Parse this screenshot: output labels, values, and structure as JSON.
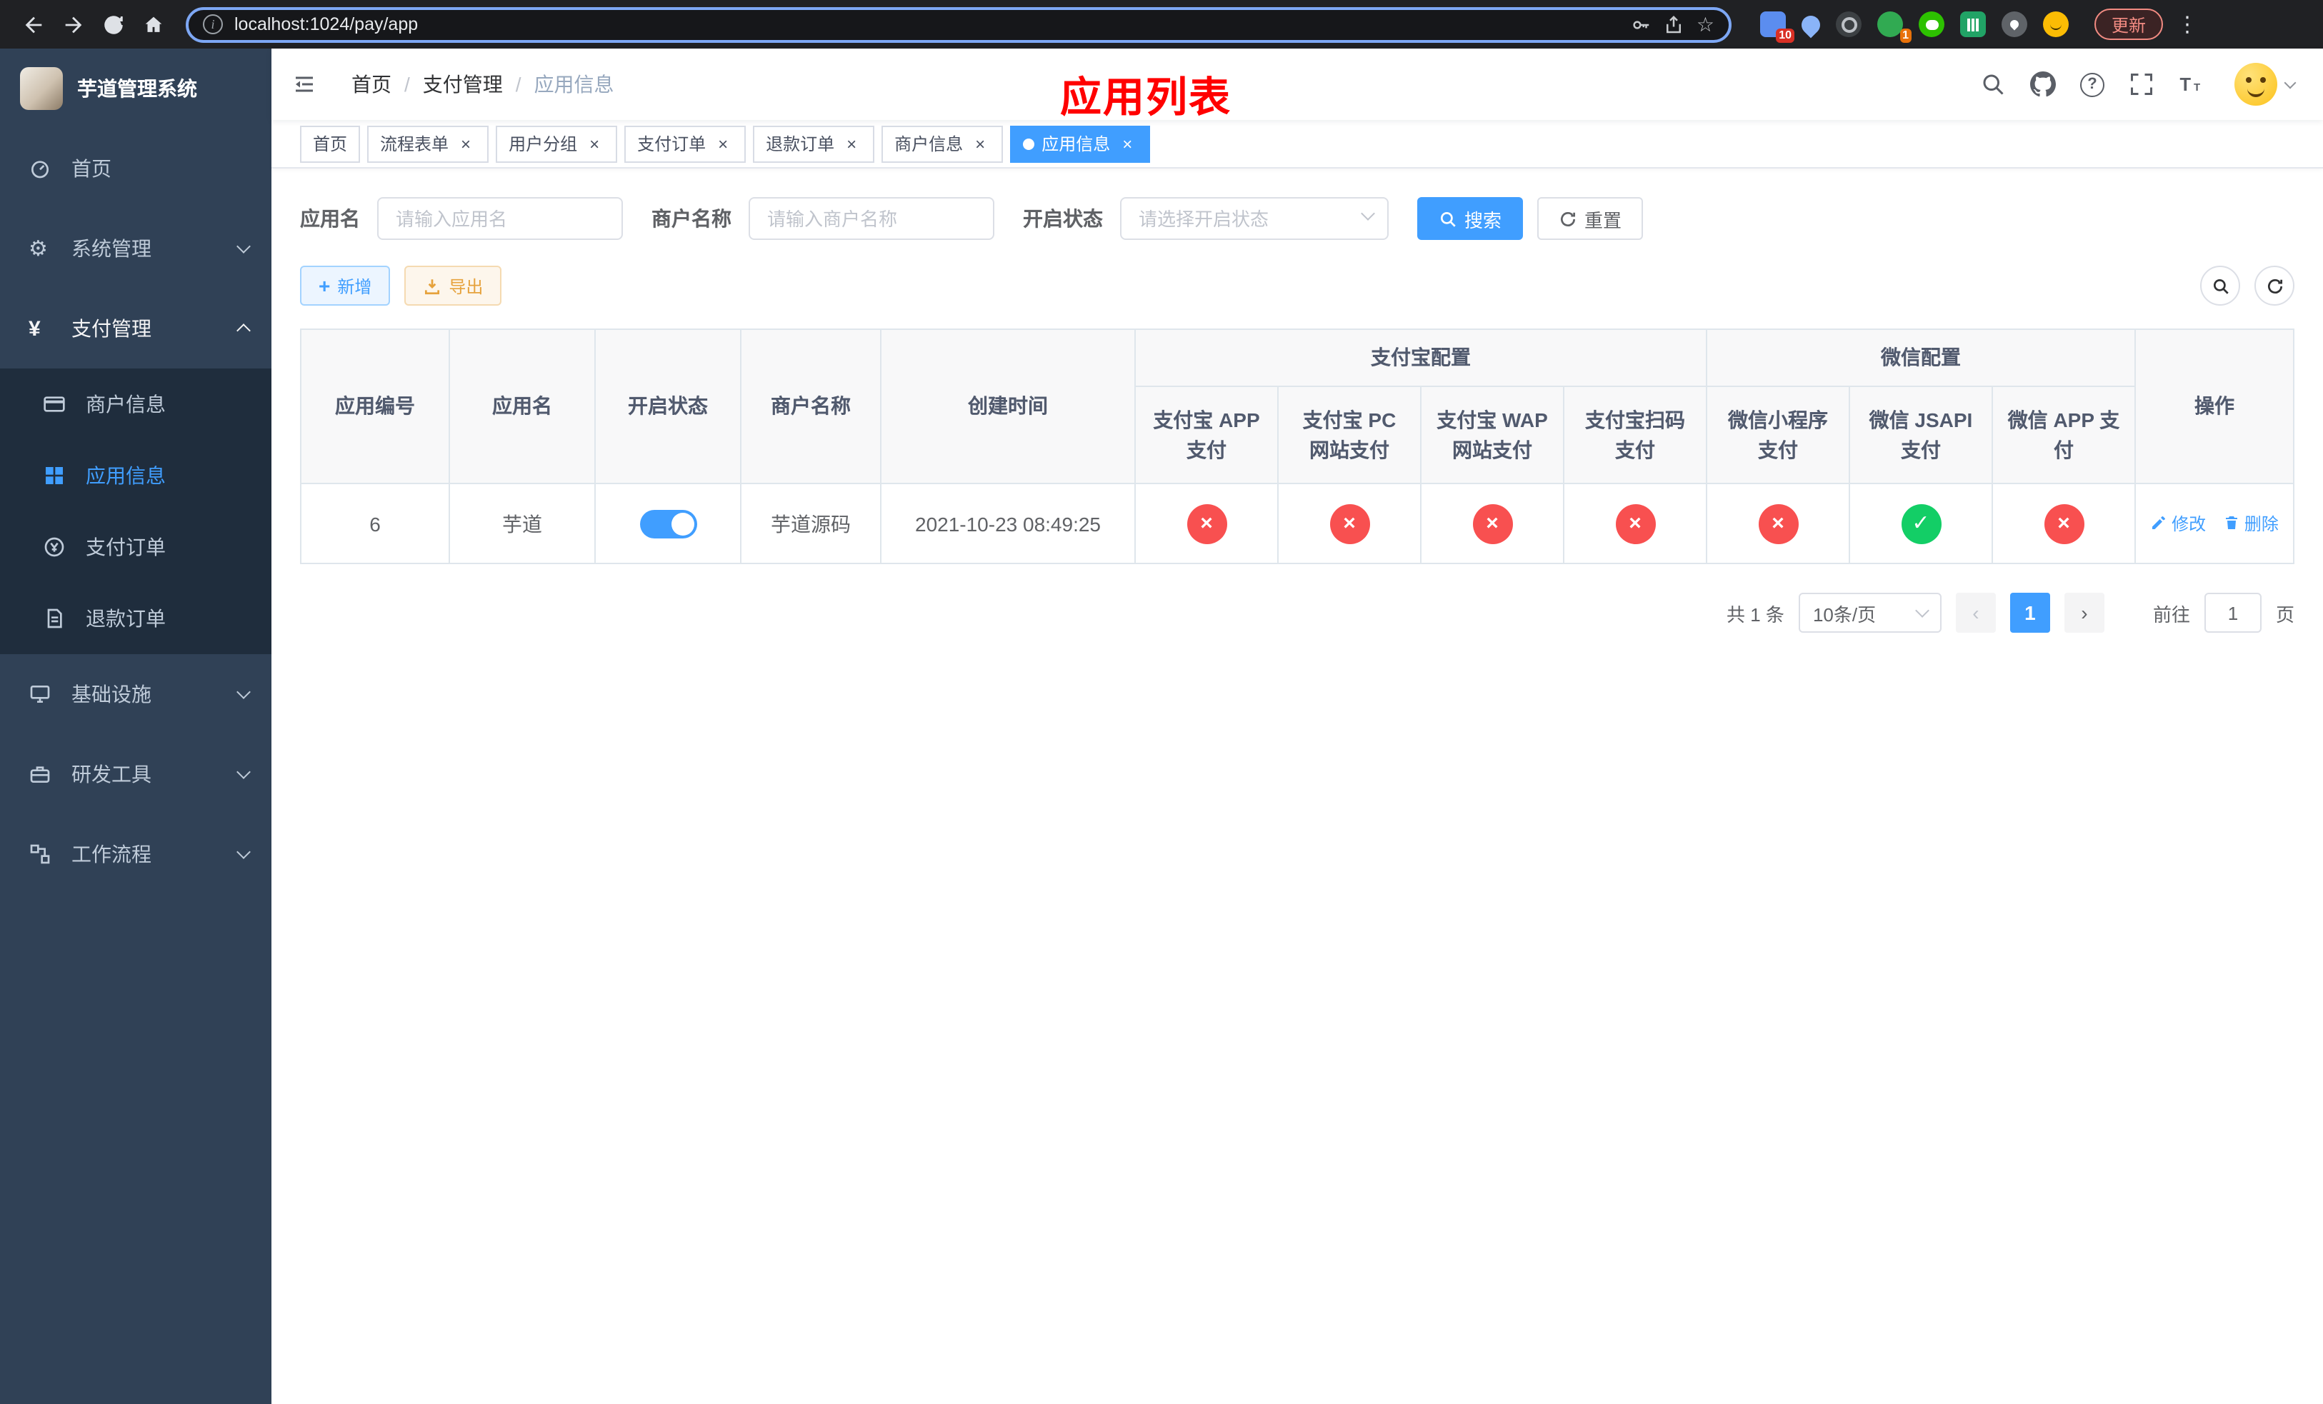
{
  "browser": {
    "url": "localhost:1024/pay/app",
    "update_label": "更新",
    "ext_badge_grid": "10",
    "ext_badge_green": "1"
  },
  "sidebar": {
    "title": "芋道管理系统",
    "items": [
      {
        "label": "首页"
      },
      {
        "label": "系统管理"
      },
      {
        "label": "支付管理"
      },
      {
        "label": "基础设施"
      },
      {
        "label": "研发工具"
      },
      {
        "label": "工作流程"
      }
    ],
    "pay_submenu": [
      {
        "label": "商户信息"
      },
      {
        "label": "应用信息"
      },
      {
        "label": "支付订单"
      },
      {
        "label": "退款订单"
      }
    ]
  },
  "header": {
    "breadcrumb": [
      "首页",
      "支付管理",
      "应用信息"
    ],
    "page_title": "应用列表"
  },
  "tabs": [
    {
      "label": "首页"
    },
    {
      "label": "流程表单"
    },
    {
      "label": "用户分组"
    },
    {
      "label": "支付订单"
    },
    {
      "label": "退款订单"
    },
    {
      "label": "商户信息"
    },
    {
      "label": "应用信息"
    }
  ],
  "filters": {
    "app_name_label": "应用名",
    "app_name_placeholder": "请输入应用名",
    "merchant_label": "商户名称",
    "merchant_placeholder": "请输入商户名称",
    "status_label": "开启状态",
    "status_placeholder": "请选择开启状态",
    "search_label": "搜索",
    "reset_label": "重置"
  },
  "toolbar": {
    "add_label": "新增",
    "export_label": "导出"
  },
  "table": {
    "headers": {
      "id": "应用编号",
      "name": "应用名",
      "status": "开启状态",
      "merchant": "商户名称",
      "created": "创建时间",
      "alipay_group": "支付宝配置",
      "wechat_group": "微信配置",
      "op": "操作",
      "pay_cols": [
        "支付宝 APP 支付",
        "支付宝 PC 网站支付",
        "支付宝 WAP 网站支付",
        "支付宝扫码支付",
        "微信小程序支付",
        "微信 JSAPI 支付",
        "微信 APP 支付"
      ]
    },
    "row": {
      "id": "6",
      "name": "芋道",
      "enabled": true,
      "merchant": "芋道源码",
      "created": "2021-10-23 08:49:25",
      "pay_status": [
        false,
        false,
        false,
        false,
        false,
        true,
        false
      ],
      "edit_label": "修改",
      "delete_label": "删除"
    }
  },
  "pagination": {
    "total": "共 1 条",
    "page_size": "10条/页",
    "page": "1",
    "goto_label": "前往",
    "goto_value": "1",
    "goto_unit": "页"
  },
  "colors": {
    "primary": "#409eff",
    "danger": "#f85050",
    "success": "#13ce66",
    "sidebar_bg": "#304156",
    "submenu_bg": "#1f2d3d",
    "title_red": "#ff0000"
  }
}
